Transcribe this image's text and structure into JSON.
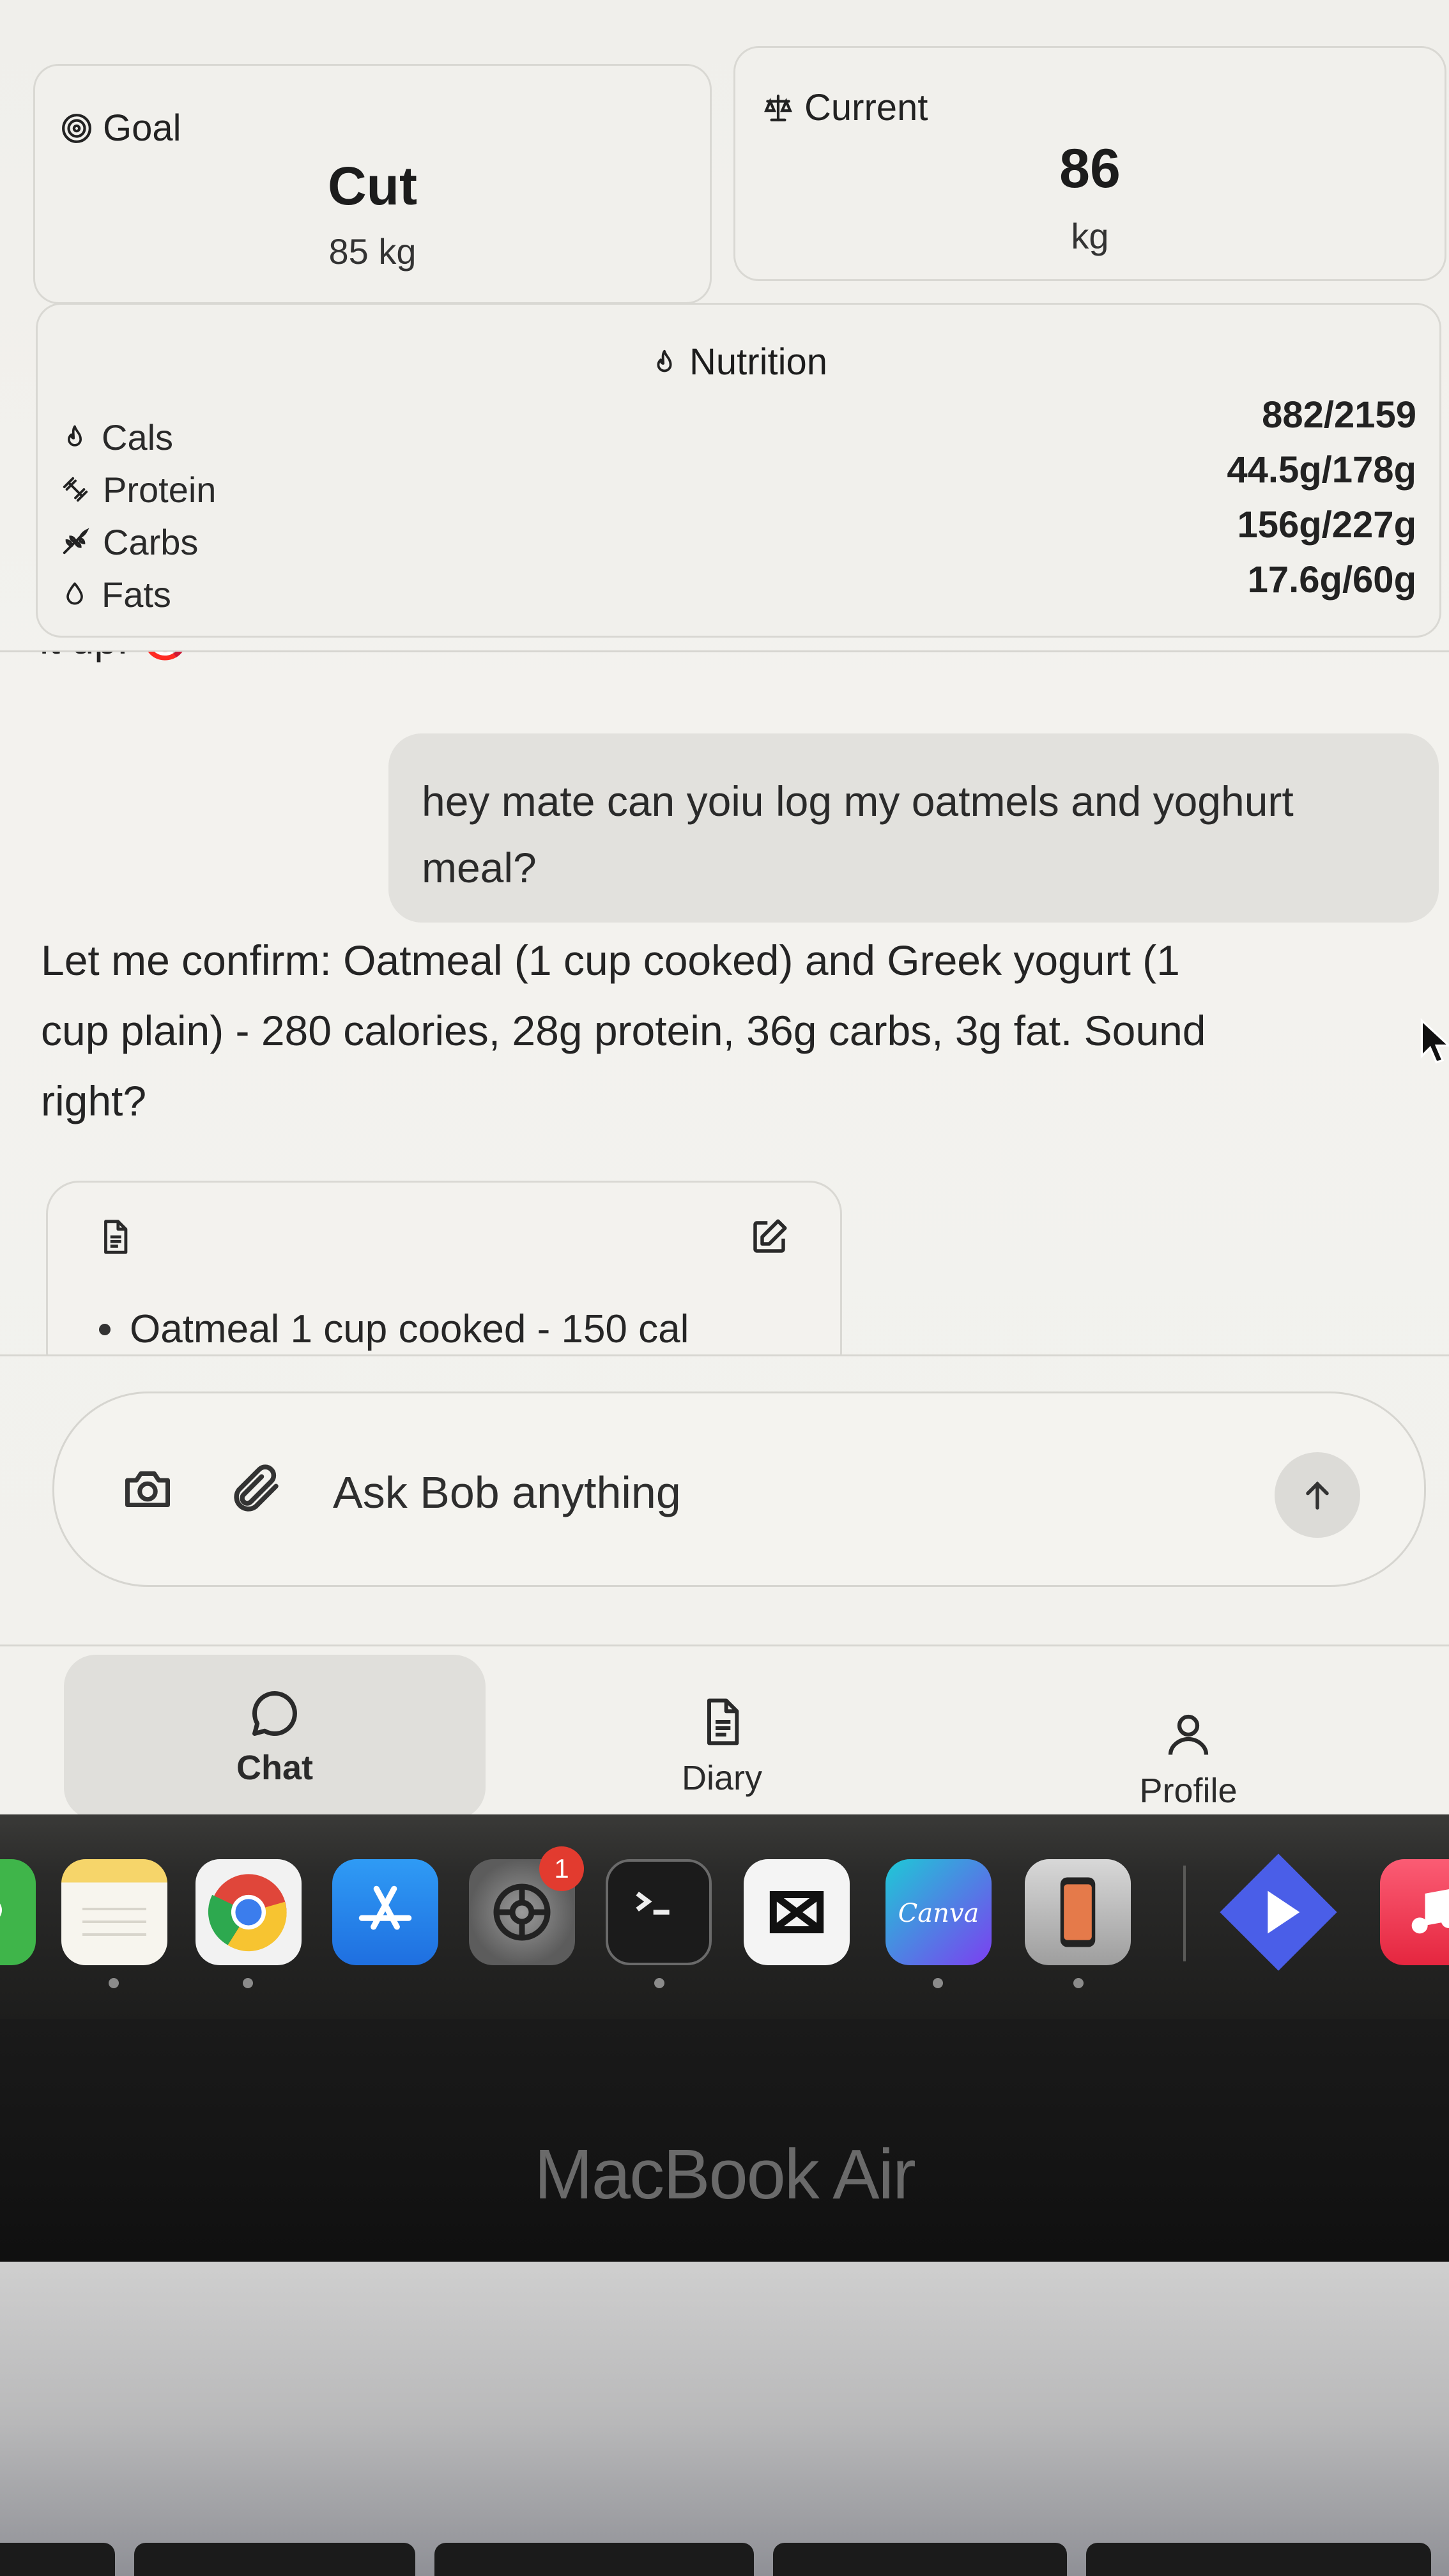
{
  "goal": {
    "label": "Goal",
    "title": "Cut",
    "target": "85 kg"
  },
  "current": {
    "label": "Current",
    "value": "86",
    "unit": "kg"
  },
  "nutrition": {
    "title": "Nutrition",
    "items": [
      {
        "label": "Cals",
        "value": "882/2159",
        "icon": "flame-icon"
      },
      {
        "label": "Protein",
        "value": "44.5g/178g",
        "icon": "dumbbell-icon"
      },
      {
        "label": "Carbs",
        "value": "156g/227g",
        "icon": "wheat-icon"
      },
      {
        "label": "Fats",
        "value": "17.6g/60g",
        "icon": "droplet-icon"
      }
    ]
  },
  "chat": {
    "cut_off_text": "it up. 🎯",
    "user_message": "hey mate can yoiu log my oatmels and yoghurt meal?",
    "assistant_message": "Let me confirm: Oatmeal (1 cup cooked) and Greek yogurt (1 cup plain) - 280 calories, 28g protein, 36g carbs, 3g fat. Sound right?",
    "log_card": {
      "items": [
        "Oatmeal 1 cup cooked - 150 cal"
      ]
    }
  },
  "composer": {
    "placeholder": "Ask Bob anything"
  },
  "tabs": [
    {
      "label": "Chat",
      "icon": "chat-bubble-icon",
      "active": true
    },
    {
      "label": "Diary",
      "icon": "document-icon",
      "active": false
    },
    {
      "label": "Profile",
      "icon": "user-icon",
      "active": false
    }
  ],
  "dock": {
    "apps": [
      "messages",
      "notes",
      "chrome",
      "app-store",
      "system-settings",
      "terminal",
      "capcut",
      "canva",
      "iphone-mirroring",
      "prime-video",
      "music"
    ],
    "badges": {
      "system-settings": "1"
    }
  },
  "device": {
    "label": "MacBook Air"
  }
}
